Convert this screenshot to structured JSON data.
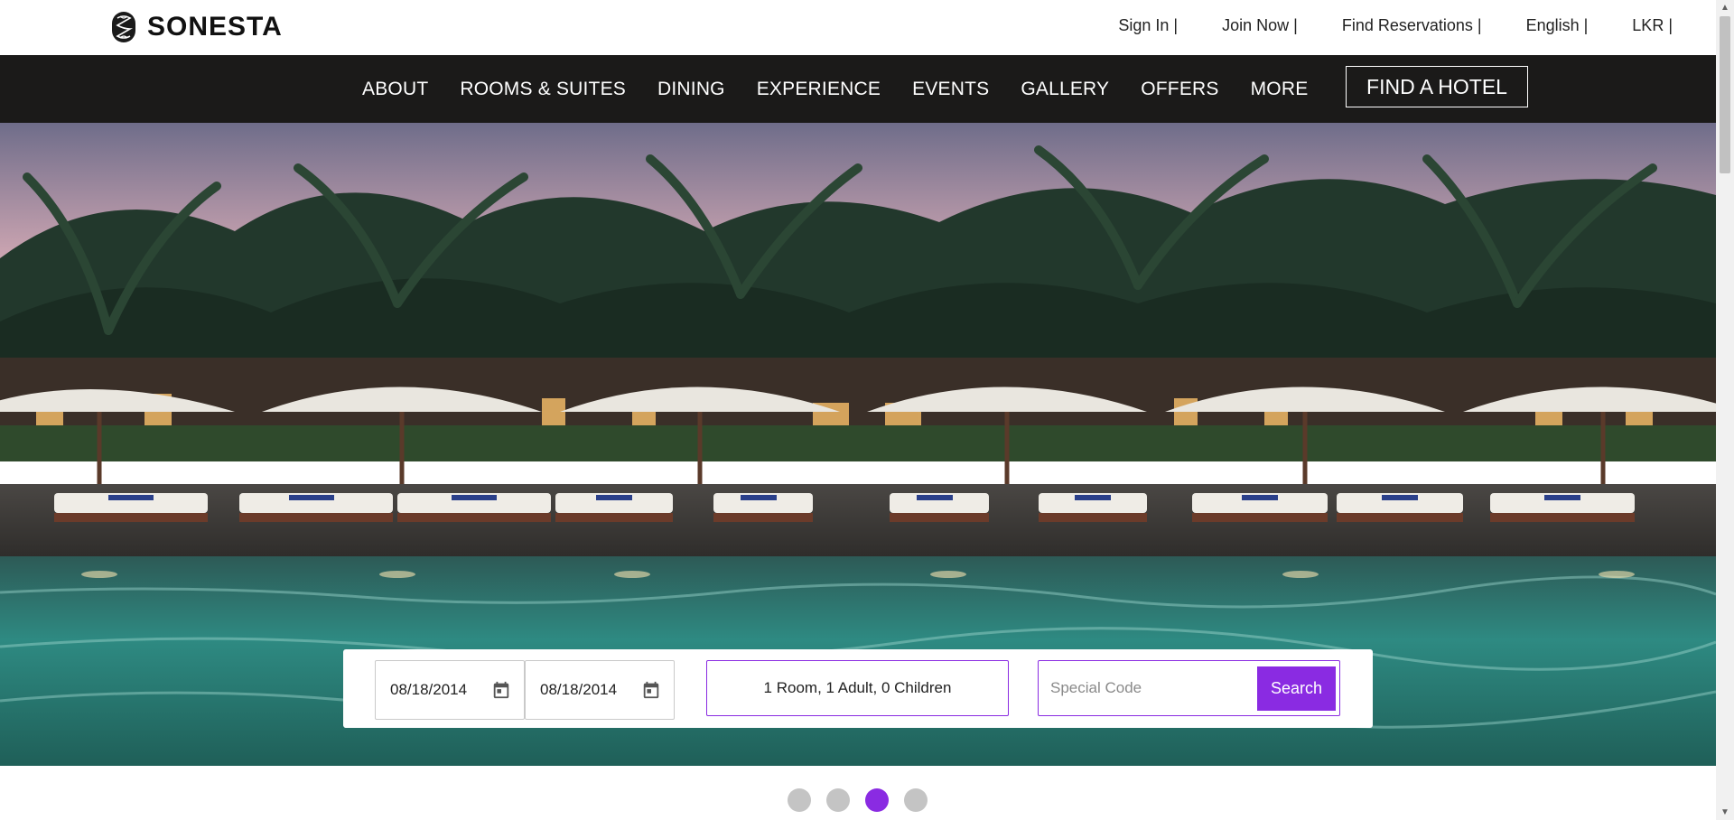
{
  "brand": {
    "name": "SONESTA"
  },
  "utility_nav": [
    {
      "label": "Sign In |"
    },
    {
      "label": "Join Now |"
    },
    {
      "label": "Find Reservations |"
    },
    {
      "label": "English |"
    },
    {
      "label": "LKR |"
    }
  ],
  "main_nav": [
    {
      "label": "ABOUT"
    },
    {
      "label": "ROOMS & SUITES"
    },
    {
      "label": "DINING"
    },
    {
      "label": "EXPERIENCE"
    },
    {
      "label": "EVENTS"
    },
    {
      "label": "GALLERY"
    },
    {
      "label": "OFFERS"
    },
    {
      "label": "MORE"
    }
  ],
  "find_hotel_label": "FIND A HOTEL",
  "booking": {
    "check_in": "08/18/2014",
    "check_out": "08/18/2014",
    "guests": "1 Room, 1 Adult, 0 Children",
    "code_placeholder": "Special Code",
    "search_label": "Search"
  },
  "carousel": {
    "total": 4,
    "active": 3
  },
  "colors": {
    "accent": "#8a2be2",
    "nav_bg": "#1b1a19"
  },
  "icons": {
    "calendar": "calendar-icon",
    "logo": "sonesta-logo-icon"
  }
}
